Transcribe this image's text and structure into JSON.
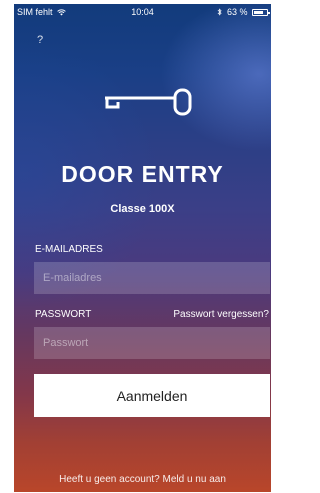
{
  "status_bar": {
    "carrier": "SIM fehlt",
    "wifi_icon": "wifi-icon",
    "time": "10:04",
    "bluetooth_icon": "bluetooth-icon",
    "battery_text": "63 %",
    "battery_level": 0.63
  },
  "help": {
    "label": "?"
  },
  "logo": {
    "icon": "key-icon"
  },
  "app": {
    "title": "DOOR ENTRY",
    "subtitle": "Classe 100X"
  },
  "form": {
    "email_label": "E-MAILADRES",
    "email_placeholder": "E-mailadres",
    "email_value": "",
    "password_label": "PASSWORT",
    "forgot_link": "Passwort vergessen?",
    "password_placeholder": "Passwort",
    "password_value": "",
    "submit_label": "Aanmelden"
  },
  "footer": {
    "signup_text": "Heeft u geen account? Meld u nu aan"
  },
  "colors": {
    "background_top": "#123b7c",
    "background_bottom": "#b9462a",
    "button_bg": "#ffffff",
    "button_text": "#222222"
  }
}
